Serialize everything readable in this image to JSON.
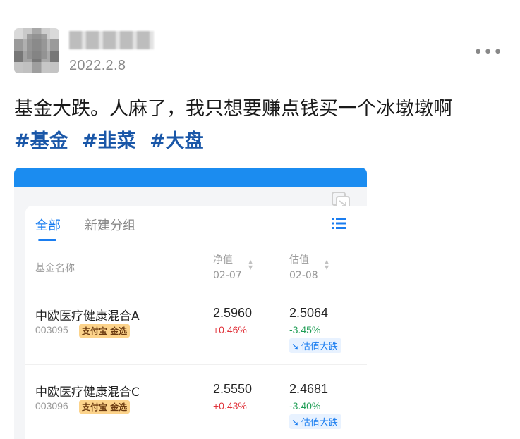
{
  "post": {
    "date": "2022.2.8",
    "more_label": "•••",
    "text": "基金大跌。人麻了，我只想要赚点钱买一个冰墩墩啊",
    "hashtags": [
      "#基金",
      "#韭菜",
      "#大盘"
    ]
  },
  "screenshot": {
    "tabs": [
      "全部",
      "新建分组"
    ],
    "columns": {
      "name": "基金名称",
      "nav_label": "净值",
      "nav_date": "02-07",
      "est_label": "估值",
      "est_date": "02-08"
    },
    "funds": [
      {
        "name": "中欧医疗健康混合A",
        "code": "003095",
        "badge": "支付宝 金选",
        "nav": "2.5960",
        "nav_change": "+0.46%",
        "estimate": "2.5064",
        "estimate_change": "-3.45%",
        "estimate_tag": "估值大跌"
      },
      {
        "name": "中欧医疗健康混合C",
        "code": "003096",
        "badge": "支付宝 金选",
        "nav": "2.5550",
        "nav_change": "+0.43%",
        "estimate": "2.4681",
        "estimate_change": "-3.40%",
        "estimate_tag": "估值大跌"
      }
    ]
  },
  "colors": {
    "accent": "#1a7df0",
    "hashtag": "#1a57a8",
    "up": "#e0323a",
    "down": "#1f9d55",
    "badge_bg": "#fcd38b"
  }
}
